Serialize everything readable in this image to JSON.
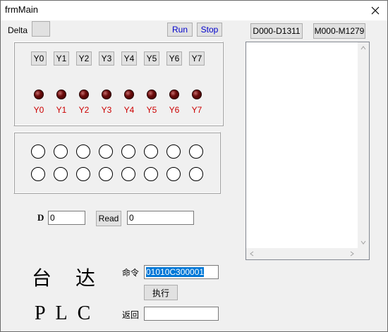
{
  "window": {
    "title": "frmMain",
    "close_glyph": "✕"
  },
  "toolbar": {
    "delta_label": "Delta",
    "run_label": "Run",
    "stop_label": "Stop",
    "d_range_label": "D000-D1311",
    "m_range_label": "M000-M1279"
  },
  "outputs": {
    "buttons": [
      "Y0",
      "Y1",
      "Y2",
      "Y3",
      "Y4",
      "Y5",
      "Y6",
      "Y7"
    ],
    "led_labels": [
      "Y0",
      "Y1",
      "Y2",
      "Y3",
      "Y4",
      "Y5",
      "Y6",
      "Y7"
    ],
    "led_color": "#6b0c0c",
    "label_color": "#cc0000"
  },
  "inputs_panel": {
    "rows": 2,
    "cols": 8
  },
  "register": {
    "label": "D",
    "address_value": "0",
    "read_label": "Read",
    "result_value": "0"
  },
  "command": {
    "brand_line1_a": "台",
    "brand_line1_b": "达",
    "brand_line2": "P L C",
    "cmd_label": "命令",
    "cmd_value": "01010C300001",
    "exec_label": "执行",
    "return_label": "返回",
    "return_value": ""
  },
  "listbox": {
    "items": []
  },
  "colors": {
    "accent_blue": "#0000cc",
    "selection": "#0078d7"
  }
}
